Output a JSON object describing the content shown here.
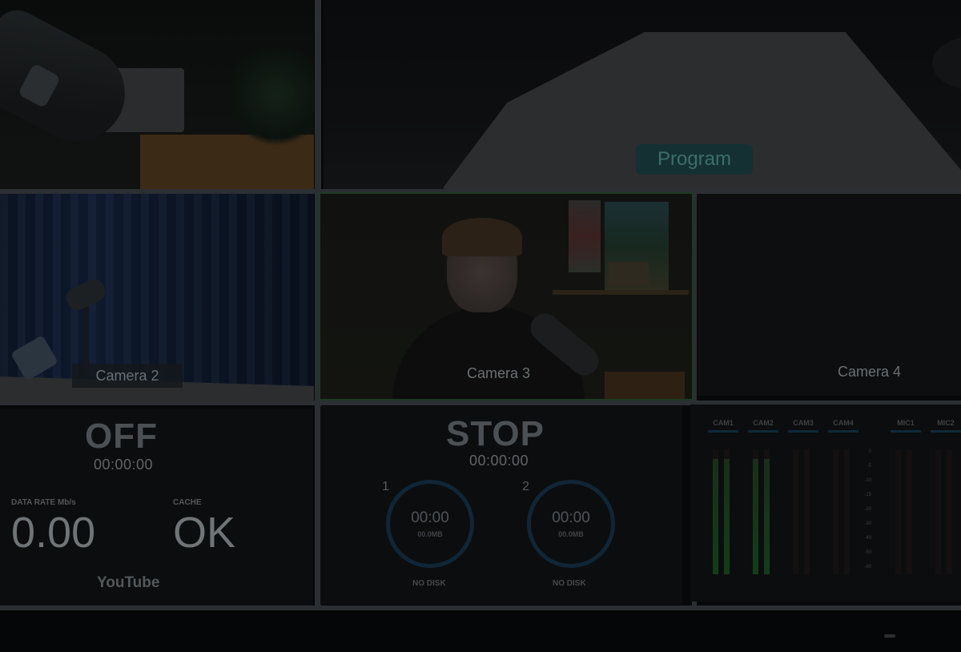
{
  "program": {
    "label": "Program"
  },
  "cameras": [
    {
      "label": "Camera 2"
    },
    {
      "label": "Camera 3"
    },
    {
      "label": "Camera 4"
    }
  ],
  "stream": {
    "status": "OFF",
    "timecode": "00:00:00",
    "data_rate_label": "DATA RATE Mb/s",
    "data_rate_value": "0.00",
    "cache_label": "CACHE",
    "cache_value": "OK",
    "platform": "YouTube"
  },
  "record": {
    "status": "STOP",
    "timecode": "00:00:00",
    "disks": [
      {
        "number": "1",
        "time": "00:00",
        "size": "00.0MB",
        "status": "NO DISK"
      },
      {
        "number": "2",
        "time": "00:00",
        "size": "00.0MB",
        "status": "NO DISK"
      }
    ]
  },
  "audio": {
    "channels": [
      {
        "name": "CAM1",
        "level": 0.92
      },
      {
        "name": "CAM2",
        "level": 0.92
      },
      {
        "name": "CAM3",
        "level": 0.0
      },
      {
        "name": "CAM4",
        "level": 0.0
      },
      {
        "name": "MIC1",
        "level": 0.0
      },
      {
        "name": "MIC2",
        "level": 0.0
      }
    ],
    "scale": [
      "0",
      "-5",
      "-10",
      "-15",
      "-20",
      "-30",
      "-40",
      "-50",
      "-60"
    ]
  },
  "colors": {
    "background": "#07080a",
    "program_label_bg": "#143032",
    "tally_green": "#1d3a22",
    "disk_ring": "#102637"
  }
}
